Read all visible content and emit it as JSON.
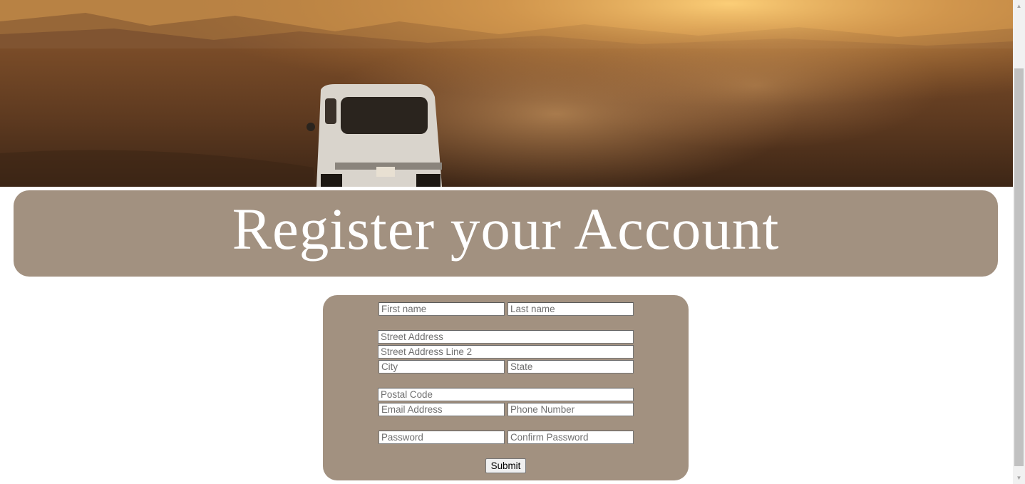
{
  "hero": {
    "image": "desert-van-photo"
  },
  "header": {
    "title": "Register your Account"
  },
  "form": {
    "first_name": {
      "placeholder": "First name",
      "value": ""
    },
    "last_name": {
      "placeholder": "Last name",
      "value": ""
    },
    "street_address": {
      "placeholder": "Street Address",
      "value": ""
    },
    "street_address_2": {
      "placeholder": "Street Address Line 2",
      "value": ""
    },
    "city": {
      "placeholder": "City",
      "value": ""
    },
    "state": {
      "placeholder": "State",
      "value": ""
    },
    "postal_code": {
      "placeholder": "Postal Code",
      "value": ""
    },
    "email": {
      "placeholder": "Email Address",
      "value": ""
    },
    "phone": {
      "placeholder": "Phone Number",
      "value": ""
    },
    "password": {
      "placeholder": "Password",
      "value": ""
    },
    "confirm_password": {
      "placeholder": "Confirm Password",
      "value": ""
    },
    "submit_label": "Submit"
  },
  "colors": {
    "panel": "#a29180",
    "title_text": "#ffffff"
  }
}
